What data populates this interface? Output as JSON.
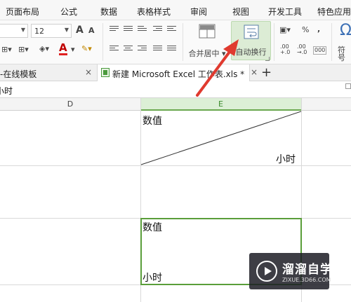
{
  "menu": [
    "页面布局",
    "公式",
    "数据",
    "表格样式",
    "审阅",
    "视图",
    "开发工具",
    "特色应用"
  ],
  "ribbon": {
    "font_size": "12",
    "grow_font": "A",
    "shrink_font": "A",
    "font_color": "A",
    "merge_center": "合并居中",
    "wrap_text": "自动换行",
    "percent": "%",
    "thousands": "000",
    "inc_decimal": ".00",
    "dec_decimal": ".00",
    "symbol": "符号"
  },
  "tabs": {
    "template_tab": "-在线模板",
    "doc_tab": "新建 Microsoft Excel 工作表.xls *",
    "close_glyph": "×",
    "new_tab": "+"
  },
  "formula_bar": {
    "content": "小时"
  },
  "grid": {
    "columns": [
      "D",
      "E"
    ],
    "cells": {
      "e1_top": "数值",
      "e1_bottom": "小时",
      "e3_top": "数值",
      "e3_bottom": "小时"
    }
  },
  "watermark": {
    "name": "溜溜自学",
    "url": "ZIXUE.3D66.COM"
  },
  "colors": {
    "selection": "#5a9e3a",
    "annotation_arrow": "#e03a2f",
    "wrap_highlight": "#dcecd5"
  }
}
